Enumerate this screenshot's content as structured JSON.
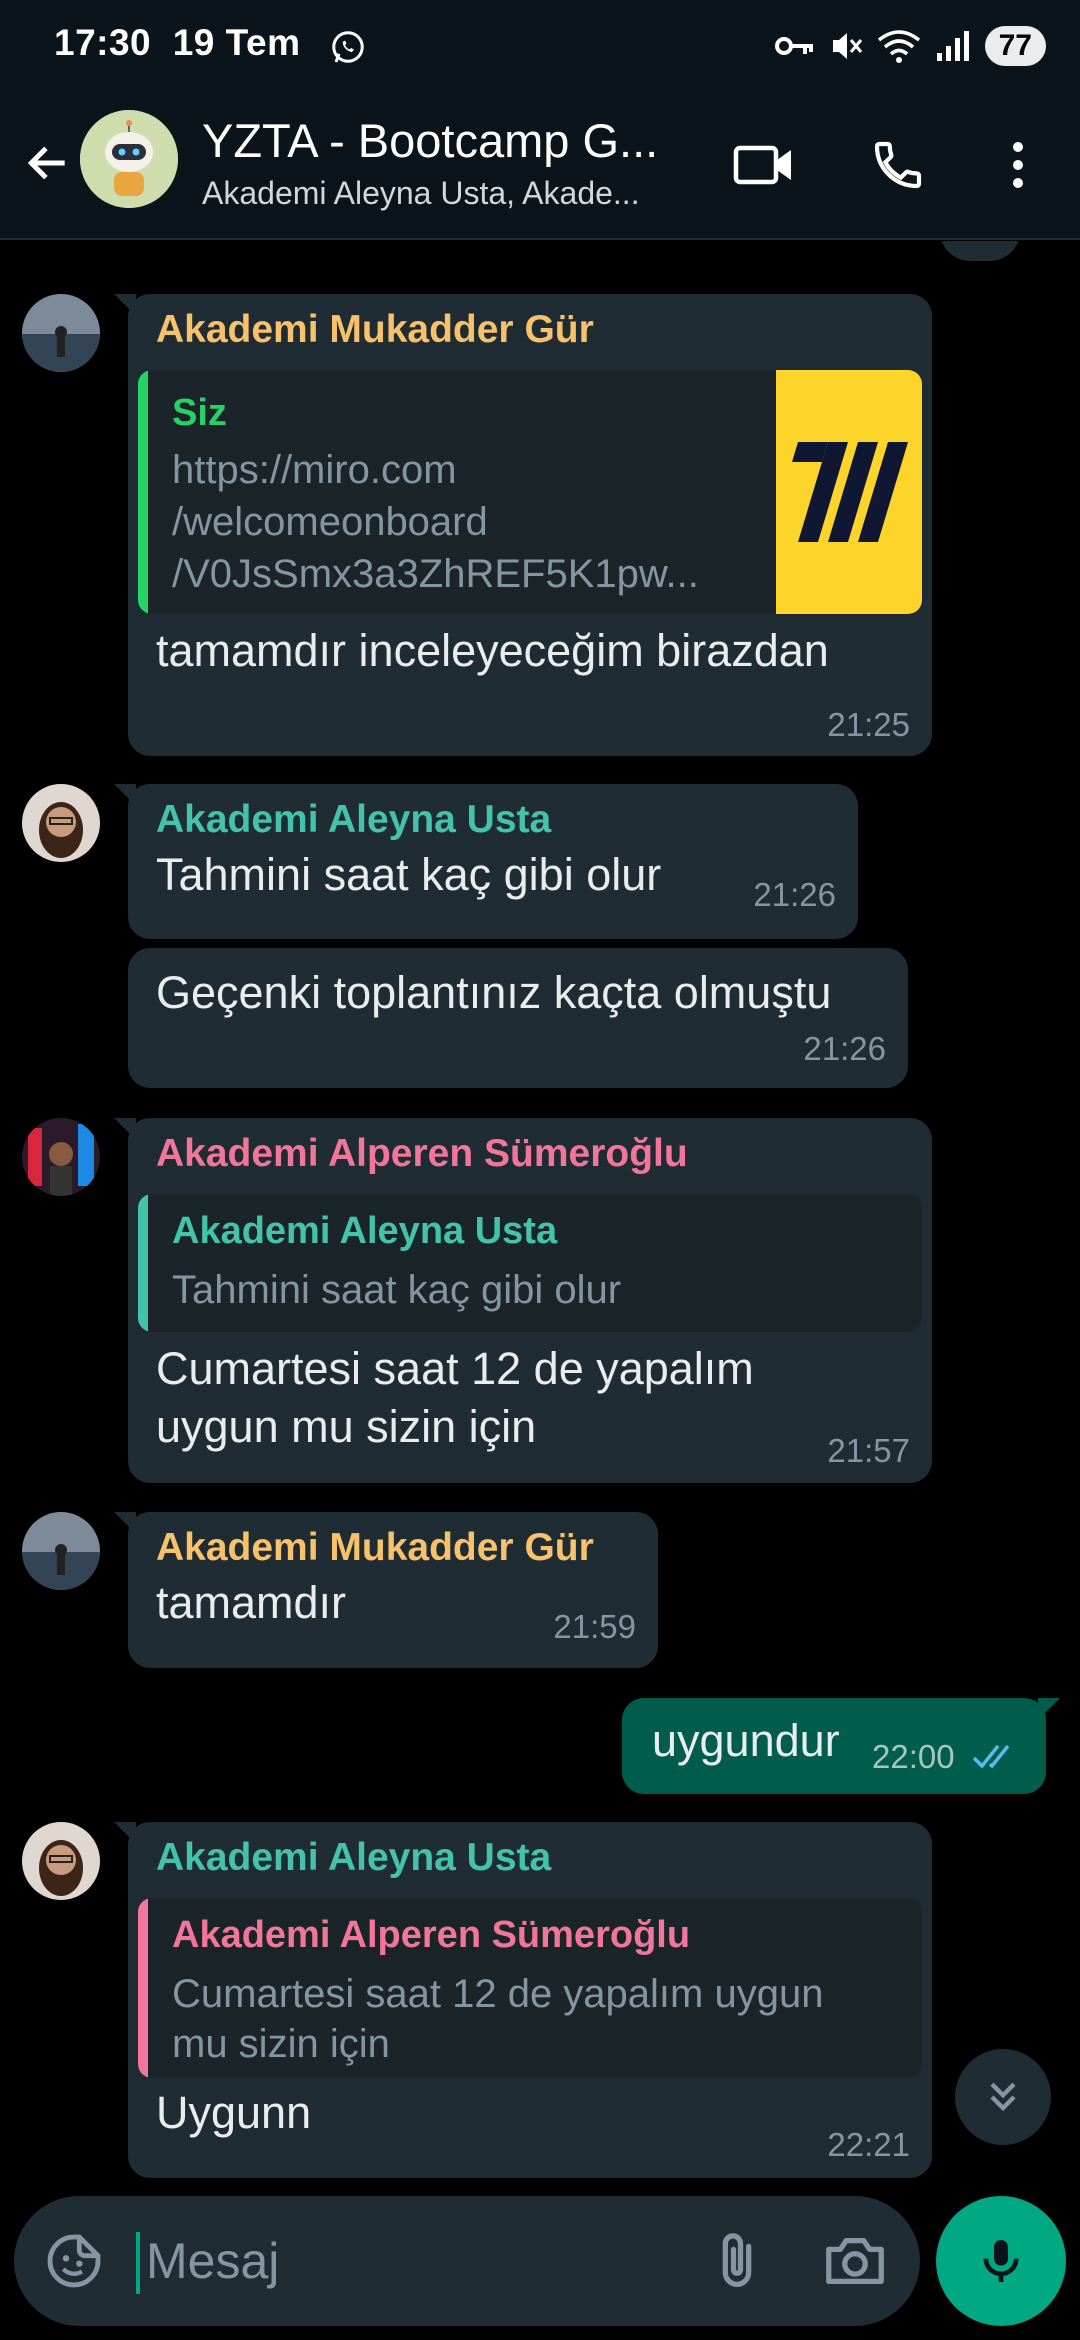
{
  "status_bar": {
    "time": "17:30",
    "date": "19 Tem",
    "battery": "77"
  },
  "header": {
    "title": "YZTA - Bootcamp G...",
    "subtitle": "Akademi Aleyna Usta, Akade..."
  },
  "colors": {
    "sender_mukadder": "#f7c26b",
    "sender_aleyna": "#43c3a8",
    "sender_alperen": "#f1769a",
    "quote_siz": "#25d366",
    "accent": "#00a884",
    "read_ticks": "#53bdeb"
  },
  "messages": [
    {
      "sender": "Akademi Mukadder Gür",
      "quote_name": "Siz",
      "quote_text": [
        "https://miro.com",
        "/welcomeonboard",
        "/V0JsSmx3a3ZhREF5K1pw..."
      ],
      "text": "tamamdır inceleyeceğim birazdan",
      "time": "21:25"
    },
    {
      "sender": "Akademi Aleyna Usta",
      "text": "Tahmini saat kaç gibi olur",
      "time": "21:26"
    },
    {
      "text": "Geçenki toplantınız kaçta olmuştu",
      "time": "21:26"
    },
    {
      "sender": "Akademi Alperen Sümeroğlu",
      "quote_name": "Akademi Aleyna Usta",
      "quote_text": "Tahmini saat kaç gibi olur",
      "text_lines": [
        "Cumartesi saat 12 de yapalım",
        "uygun mu sizin için"
      ],
      "time": "21:57"
    },
    {
      "sender": "Akademi Mukadder Gür",
      "text": "tamamdır",
      "time": "21:59"
    },
    {
      "text": "uygundur",
      "time": "22:00",
      "outgoing": true
    },
    {
      "sender": "Akademi Aleyna Usta",
      "quote_name": "Akademi Alperen Sümeroğlu",
      "quote_text": [
        "Cumartesi saat 12 de yapalım uygun",
        "mu sizin için"
      ],
      "text": "Uygunn",
      "time": "22:21"
    }
  ],
  "input": {
    "placeholder": "Mesaj"
  },
  "icons": {
    "back": "back-arrow-icon",
    "video": "video-call-icon",
    "call": "phone-icon",
    "menu": "more-vert-icon",
    "emoji": "sticker-icon",
    "attach": "paperclip-icon",
    "camera": "camera-icon",
    "mic": "mic-icon",
    "scroll": "double-chevron-down-icon"
  }
}
